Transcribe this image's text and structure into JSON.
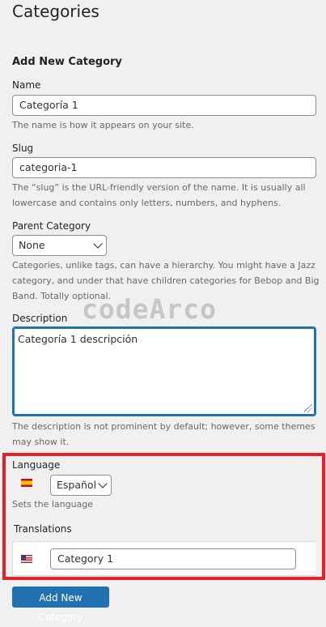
{
  "header": {
    "title": "Categories"
  },
  "form": {
    "section_title": "Add New Category",
    "name": {
      "label": "Name",
      "value": "Categoría 1",
      "help": "The name is how it appears on your site."
    },
    "slug": {
      "label": "Slug",
      "value": "categoria-1",
      "help": "The “slug” is the URL-friendly version of the name. It is usually all lowercase and contains only letters, numbers, and hyphens."
    },
    "parent": {
      "label": "Parent Category",
      "selected": "None",
      "help": "Categories, unlike tags, can have a hierarchy. You might have a Jazz category, and under that have children categories for Bebop and Big Band. Totally optional."
    },
    "description": {
      "label": "Description",
      "value": "Categoría 1 descripción",
      "help": "The description is not prominent by default; however, some themes may show it."
    },
    "language": {
      "label": "Language",
      "selected": "Español",
      "help": "Sets the language",
      "flag_icon": "spain-flag-icon"
    },
    "translations": {
      "label": "Translations",
      "value": "Category 1",
      "flag_icon": "us-flag-icon"
    },
    "submit_label": "Add New Category"
  },
  "watermark": "codeArco",
  "colors": {
    "primary": "#2271b1",
    "highlight": "#e5202a",
    "background": "#f0f0f1",
    "help_text": "#646970"
  }
}
